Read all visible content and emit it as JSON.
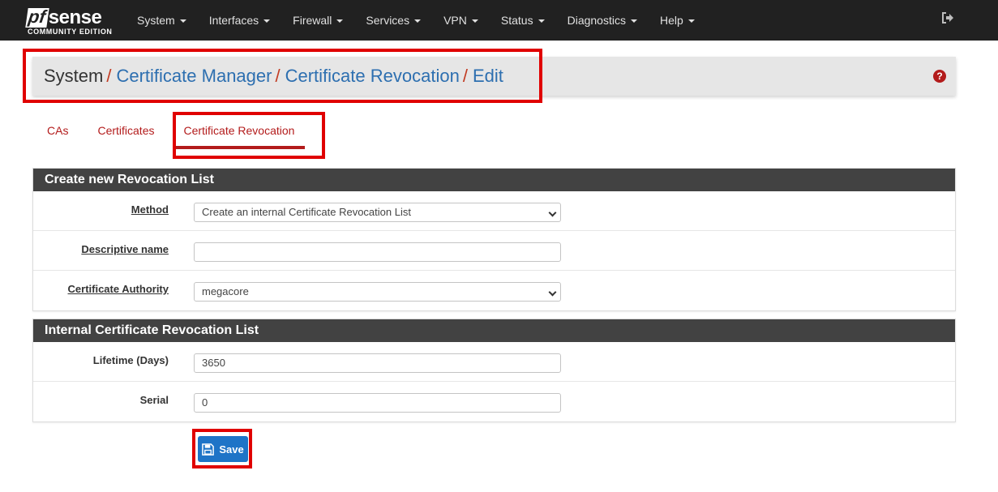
{
  "brand": {
    "logo_prefix": "pf",
    "logo_suffix": "sense",
    "edition": "COMMUNITY EDITION"
  },
  "nav": {
    "items": [
      {
        "label": "System"
      },
      {
        "label": "Interfaces"
      },
      {
        "label": "Firewall"
      },
      {
        "label": "Services"
      },
      {
        "label": "VPN"
      },
      {
        "label": "Status"
      },
      {
        "label": "Diagnostics"
      },
      {
        "label": "Help"
      }
    ],
    "logout_icon": "sign-out-icon"
  },
  "breadcrumb": {
    "root": "System",
    "separator": "/",
    "links": [
      "Certificate Manager",
      "Certificate Revocation",
      "Edit"
    ],
    "help_icon": "question-circle-icon",
    "help_symbol": "?"
  },
  "tabs": [
    {
      "label": "CAs",
      "active": false
    },
    {
      "label": "Certificates",
      "active": false
    },
    {
      "label": "Certificate Revocation",
      "active": true
    }
  ],
  "panels": {
    "create": {
      "heading": "Create new Revocation List",
      "method_label": "Method",
      "method_value": "Create an internal Certificate Revocation List",
      "descr_label": "Descriptive name",
      "descr_value": "",
      "ca_label": "Certificate Authority",
      "ca_value": "megacore"
    },
    "internal": {
      "heading": "Internal Certificate Revocation List",
      "lifetime_label": "Lifetime (Days)",
      "lifetime_value": "3650",
      "serial_label": "Serial",
      "serial_value": "0"
    }
  },
  "actions": {
    "save_label": "Save",
    "save_icon": "save-icon"
  },
  "colors": {
    "navbar": "#212121",
    "accent_red": "#b31b1b",
    "link_blue": "#2d6fb0",
    "save_blue": "#1e74c7",
    "panel_heading": "#424242",
    "annotation_red": "#e00000"
  }
}
